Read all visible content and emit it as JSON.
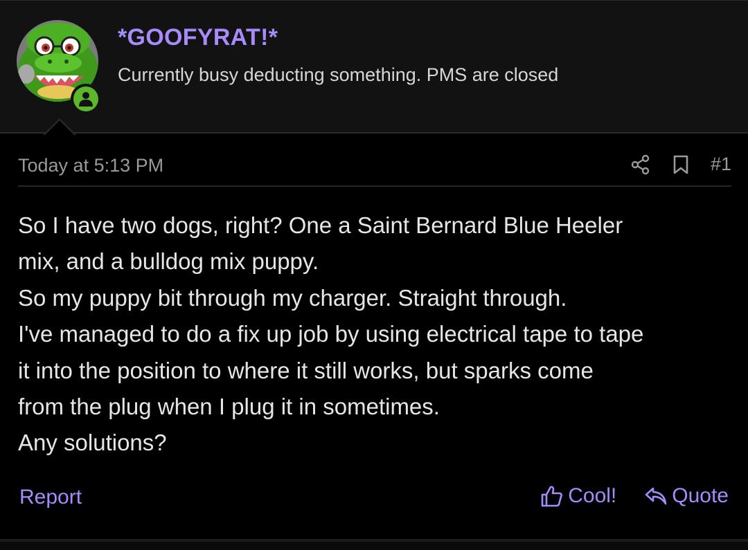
{
  "author": {
    "username": "*GOOFYRAT!*",
    "user_title": "Currently busy deducting something. PMS are closed",
    "avatar_icon": "green-crocodile-avatar",
    "online_icon": "user-online-icon",
    "online_color": "#5cb82a"
  },
  "post": {
    "timestamp": "Today at 5:13 PM",
    "number": "#1",
    "share_icon": "share-icon",
    "bookmark_icon": "bookmark-icon",
    "body_lines": [
      "So I have two dogs, right? One a Saint Bernard Blue Heeler",
      "mix, and a bulldog mix puppy.",
      "So my puppy bit through my charger. Straight through.",
      "I've managed to do a fix up job by using electrical tape to tape",
      "it into the position to where it still works, but sparks come",
      "from the plug when I plug it in sometimes.",
      "Any solutions?"
    ]
  },
  "actions": {
    "report_label": "Report",
    "like_label": "Cool!",
    "like_icon": "thumbs-up-icon",
    "quote_label": "Quote",
    "quote_icon": "reply-arrow-icon"
  },
  "colors": {
    "accent": "#a78bfa",
    "background": "#000000",
    "header_background": "#121212"
  }
}
